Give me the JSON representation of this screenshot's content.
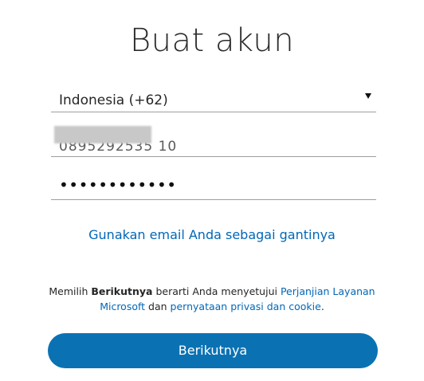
{
  "title": "Buat akun",
  "country_select": {
    "value": "Indonesia (+62)"
  },
  "phone_field": {
    "value": "0895292535 10"
  },
  "password_field": {
    "value": "••••••••••••"
  },
  "alt_link": "Gunakan email Anda sebagai gantinya",
  "terms": {
    "prefix": "Memilih ",
    "bold": "Berikutnya",
    "middle": " berarti Anda menyetujui ",
    "link1": "Perjanjian Layanan Microsoft",
    "and": " dan ",
    "link2": "pernyataan privasi dan cookie",
    "suffix": "."
  },
  "next_button": "Berikutnya",
  "colors": {
    "accent": "#0067b8",
    "button": "#0a72b3"
  }
}
